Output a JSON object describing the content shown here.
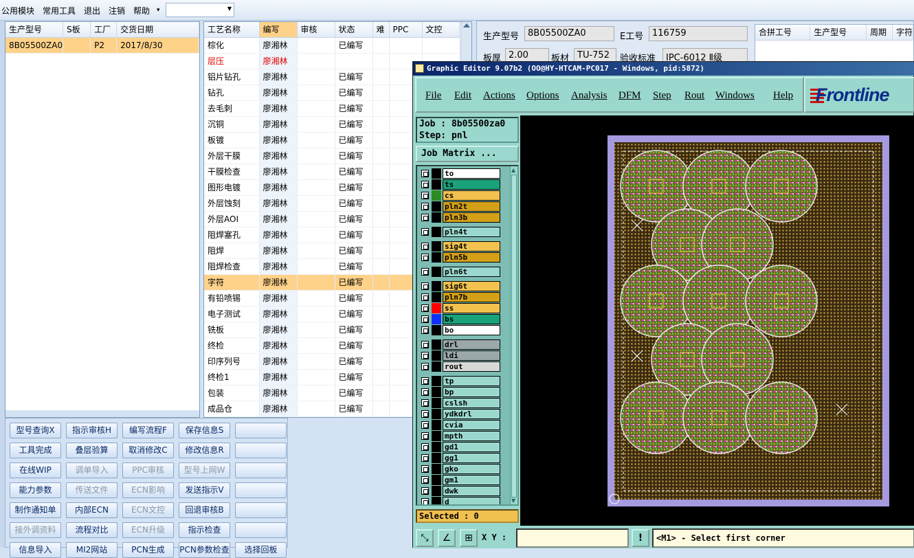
{
  "menubar": {
    "items": [
      "公用模块",
      "常用工具",
      "退出",
      "注销",
      "帮助"
    ],
    "dropdown_arrow": "▾"
  },
  "order_table": {
    "headers": [
      "生产型号",
      "S板",
      "工厂",
      "交货日期"
    ],
    "rows": [
      [
        "8B05500ZA0",
        "",
        "P2",
        "2017/8/30"
      ]
    ]
  },
  "process_table": {
    "headers": [
      "工艺名称",
      "编写",
      "审核",
      "状态",
      "难",
      "PPC",
      "文控"
    ],
    "rows": [
      [
        "棕化",
        "廖湘林",
        "",
        "已编写"
      ],
      [
        "层压",
        "廖湘林",
        "",
        ""
      ],
      [
        "铝片钻孔",
        "廖湘林",
        "",
        "已编写"
      ],
      [
        "钻孔",
        "廖湘林",
        "",
        "已编写"
      ],
      [
        "去毛刺",
        "廖湘林",
        "",
        "已编写"
      ],
      [
        "沉铜",
        "廖湘林",
        "",
        "已编写"
      ],
      [
        "板镀",
        "廖湘林",
        "",
        "已编写"
      ],
      [
        "外层干膜",
        "廖湘林",
        "",
        "已编写"
      ],
      [
        "干膜检查",
        "廖湘林",
        "",
        "已编写"
      ],
      [
        "图形电镀",
        "廖湘林",
        "",
        "已编写"
      ],
      [
        "外层蚀刻",
        "廖湘林",
        "",
        "已编写"
      ],
      [
        "外层AOI",
        "廖湘林",
        "",
        "已编写"
      ],
      [
        "阻焊塞孔",
        "廖湘林",
        "",
        "已编写"
      ],
      [
        "阻焊",
        "廖湘林",
        "",
        "已编写"
      ],
      [
        "阻焊检查",
        "廖湘林",
        "",
        "已编写"
      ],
      [
        "字符",
        "廖湘林",
        "",
        "已编写"
      ],
      [
        "有铅喷锡",
        "廖湘林",
        "",
        "已编写"
      ],
      [
        "电子测试",
        "廖湘林",
        "",
        "已编写"
      ],
      [
        "铣板",
        "廖湘林",
        "",
        "已编写"
      ],
      [
        "终检",
        "廖湘林",
        "",
        "已编写"
      ],
      [
        "印序列号",
        "廖湘林",
        "",
        "已编写"
      ],
      [
        "终检1",
        "廖湘林",
        "",
        "已编写"
      ],
      [
        "包装",
        "廖湘林",
        "",
        "已编写"
      ],
      [
        "成品仓",
        "廖湘林",
        "",
        "已编写"
      ]
    ]
  },
  "buttons": [
    [
      "型号查询X",
      "指示审核H",
      "编写流程F",
      "保存信息S",
      ""
    ],
    [
      "工具完成",
      "叠层验算",
      "取消修改C",
      "修改信息R",
      ""
    ],
    [
      "在线WIP",
      "调单导入",
      "PPC审核",
      "型号上网W",
      ""
    ],
    [
      "能力参数",
      "传送文件",
      "ECN影响",
      "发送指示V",
      ""
    ],
    [
      "制作通知单",
      "内部ECN",
      "ECN文控",
      "回退审核B",
      ""
    ],
    [
      "接外调资料",
      "流程对比",
      "ECN升级",
      "指示检查",
      ""
    ],
    [
      "信息导入",
      "MI2网站",
      "PCN生成",
      "PCN参数检查",
      "选择回板"
    ]
  ],
  "info": {
    "model_label": "生产型号",
    "model_value": "8B05500ZA0",
    "eno_label": "E工号",
    "eno_value": "116759",
    "thickness_label": "板厚",
    "thickness_value": "2.00",
    "material_label": "板材",
    "material_value": "TU-752",
    "standard_label": "验收标准",
    "standard_value": "IPC-6012 Ⅱ级"
  },
  "combine_table": {
    "headers": [
      "合拼工号",
      "生产型号",
      "周期",
      "字符"
    ]
  },
  "genesis": {
    "title": "Graphic Editor 9.07b2 (OO@HY-HTCAM-PC017 - Windows, pid:5872)",
    "menu": [
      "File",
      "Edit",
      "Actions",
      "Options",
      "Analysis",
      "DFM",
      "Step",
      "Rout",
      "Windows",
      "Help"
    ],
    "logo": "Frontline",
    "job": "Job : 8b05500za0",
    "step": "Step: pnl",
    "job_matrix": "Job Matrix ...",
    "layers": [
      {
        "name": "to",
        "color": "#ffffff",
        "swatch": "#000000"
      },
      {
        "name": "ts",
        "color": "#1aa37a",
        "swatch": "#000000"
      },
      {
        "name": "cs",
        "color": "#f2c14e",
        "swatch": "#2e8b22"
      },
      {
        "name": "pln2t",
        "color": "#d4a017",
        "swatch": "#000000"
      },
      {
        "name": "pln3b",
        "color": "#d4a017",
        "swatch": "#000000"
      },
      {
        "name": "pln4t",
        "color": "#9ad7cd",
        "swatch": "#000000"
      },
      {
        "name": "sig4t",
        "color": "#f2c14e",
        "swatch": "#000000"
      },
      {
        "name": "pln5b",
        "color": "#d4a017",
        "swatch": "#000000"
      },
      {
        "name": "pln6t",
        "color": "#9ad7cd",
        "swatch": "#000000"
      },
      {
        "name": "sig6t",
        "color": "#f2c14e",
        "swatch": "#000000"
      },
      {
        "name": "pln7b",
        "color": "#d4a017",
        "swatch": "#000000"
      },
      {
        "name": "ss",
        "color": "#f2c14e",
        "swatch": "#ff0000"
      },
      {
        "name": "bs",
        "color": "#1aa37a",
        "swatch": "#1030ff"
      },
      {
        "name": "bo",
        "color": "#ffffff",
        "swatch": "#000000"
      },
      {
        "name": "drl",
        "color": "#9aa8aa",
        "swatch": "#000000"
      },
      {
        "name": "ldi",
        "color": "#9aa8aa",
        "swatch": "#000000"
      },
      {
        "name": "rout",
        "color": "#d8d8d8",
        "swatch": "#000000"
      },
      {
        "name": "tp",
        "color": "#9ad7cd",
        "swatch": "#000000"
      },
      {
        "name": "bp",
        "color": "#9ad7cd",
        "swatch": "#000000"
      },
      {
        "name": "cslsh",
        "color": "#9ad7cd",
        "swatch": "#000000"
      },
      {
        "name": "ydkdrl",
        "color": "#9ad7cd",
        "swatch": "#000000"
      },
      {
        "name": "cvia",
        "color": "#9ad7cd",
        "swatch": "#000000"
      },
      {
        "name": "mpth",
        "color": "#9ad7cd",
        "swatch": "#000000"
      },
      {
        "name": "gd1",
        "color": "#9ad7cd",
        "swatch": "#000000"
      },
      {
        "name": "gg1",
        "color": "#9ad7cd",
        "swatch": "#000000"
      },
      {
        "name": "gko",
        "color": "#9ad7cd",
        "swatch": "#000000"
      },
      {
        "name": "gm1",
        "color": "#9ad7cd",
        "swatch": "#000000"
      },
      {
        "name": "dwk",
        "color": "#9ad7cd",
        "swatch": "#000000"
      },
      {
        "name": "d",
        "color": "#9ad7cd",
        "swatch": "#000000"
      }
    ],
    "selected": "Selected : 0",
    "xy_label": "X Y :",
    "message": "<M1> - Select first corner"
  }
}
